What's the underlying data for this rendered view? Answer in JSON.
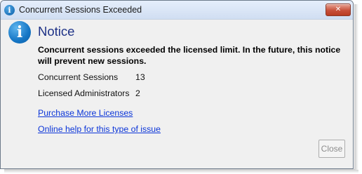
{
  "window": {
    "title": "Concurrent Sessions Exceeded",
    "close_glyph": "✕",
    "title_icon": "info-icon"
  },
  "notice": {
    "icon": "info-icon",
    "icon_glyph": "i",
    "heading": "Notice",
    "message": "Concurrent sessions exceeded the licensed limit. In the future, this notice will prevent new sessions."
  },
  "details": [
    {
      "label": "Concurrent Sessions",
      "value": "13"
    },
    {
      "label": "Licensed Administrators",
      "value": "2"
    }
  ],
  "links": {
    "purchase": "Purchase More Licenses",
    "help": "Online help for this type of issue"
  },
  "buttons": {
    "close": "Close"
  },
  "colors": {
    "heading": "#1e3287",
    "link": "#0b35d8",
    "titlebar_close": "#c8513b",
    "info_icon": "#1576c5"
  }
}
